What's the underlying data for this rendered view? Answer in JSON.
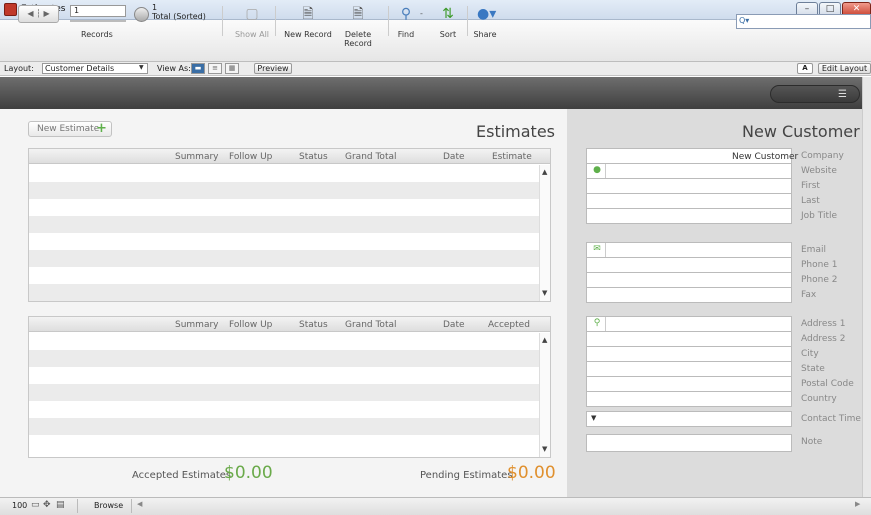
{
  "window": {
    "title": "Estimates",
    "minimize": "–",
    "maximize": "□",
    "close": "✕"
  },
  "toolbar": {
    "record_number": "1",
    "records_label": "Records",
    "found_count": "1",
    "found_total": "Total (Sorted)",
    "show_all": "Show All",
    "new_record": "New Record",
    "delete_record": "Delete Record",
    "find": "Find",
    "sort": "Sort",
    "share": "Share",
    "search_value": ""
  },
  "layoutbar": {
    "layout_label": "Layout:",
    "layout_value": "Customer Details",
    "view_as_label": "View As:",
    "preview": "Preview",
    "font_button": "A",
    "edit_layout": "Edit Layout"
  },
  "estimates": {
    "new_estimate": "New Estimate",
    "title": "Estimates",
    "portal1_columns": [
      "Summary",
      "Follow Up",
      "Status",
      "Grand Total",
      "Date",
      "Estimate"
    ],
    "portal2_columns": [
      "Summary",
      "Follow Up",
      "Status",
      "Grand Total",
      "Date",
      "Accepted"
    ],
    "accepted_label": "Accepted Estimates",
    "accepted_value": "$0.00",
    "pending_label": "Pending Estimates",
    "pending_value": "$0.00"
  },
  "customer": {
    "title": "New Customer",
    "company_value": "New Customer",
    "labels": {
      "company": "Company",
      "website": "Website",
      "first": "First",
      "last": "Last",
      "job_title": "Job Title",
      "email": "Email",
      "phone1": "Phone 1",
      "phone2": "Phone 2",
      "fax": "Fax",
      "address1": "Address 1",
      "address2": "Address 2",
      "city": "City",
      "state": "State",
      "postal": "Postal Code",
      "country": "Country",
      "contact_time": "Contact Time",
      "note": "Note"
    }
  },
  "statusbar": {
    "zoom": "100",
    "mode": "Browse"
  },
  "icons": [
    "app-icon",
    "nav-arrows-icon",
    "pie-icon",
    "show-all-icon",
    "new-record-icon",
    "delete-record-icon",
    "find-icon",
    "sort-icon",
    "share-icon",
    "search-icon",
    "plus-icon",
    "globe-icon",
    "mail-icon",
    "pin-icon",
    "list-icon"
  ]
}
